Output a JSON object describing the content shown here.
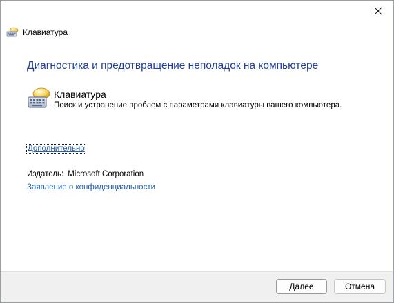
{
  "window": {
    "title": "Клавиатура",
    "close_icon": "close-icon",
    "title_icon": "keyboard-troubleshooter-icon"
  },
  "main": {
    "heading": "Диагностика и предотвращение неполадок на компьютере",
    "item": {
      "icon": "keyboard-troubleshooter-icon",
      "title": "Клавиатура",
      "description": "Поиск и устранение проблем с параметрами клавиатуры вашего компьютера."
    },
    "advanced_link": "Дополнительно",
    "publisher_label": "Издатель:",
    "publisher_value": "Microsoft Corporation",
    "privacy_link": "Заявление о конфиденциальности"
  },
  "footer": {
    "next_label": "Далее",
    "cancel_label": "Отмена"
  },
  "colors": {
    "heading": "#1f3f9f",
    "link": "#1f5fb4",
    "footer_bg": "#f0f0f0"
  }
}
